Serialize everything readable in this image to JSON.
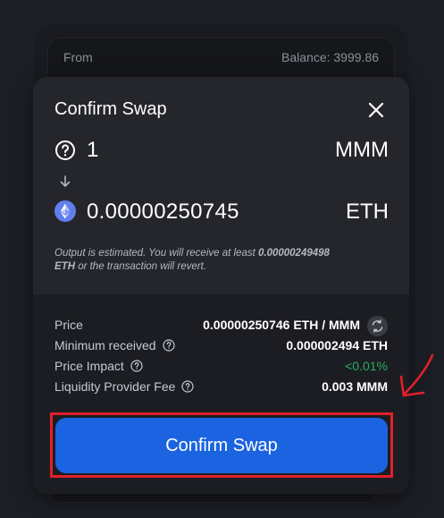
{
  "background": {
    "from_label": "From",
    "balance_text": "Balance: 3999.86"
  },
  "modal": {
    "title": "Confirm Swap",
    "input": {
      "amount": "1",
      "token": "MMM",
      "icon": "question-circle-icon"
    },
    "output": {
      "amount": "0.00000250745",
      "token": "ETH",
      "icon": "ethereum-icon"
    },
    "note": {
      "part1": "Output is estimated. You will receive at least ",
      "min_amount": "0.00000249498",
      "part2": " ETH",
      "part3": " or the transaction will revert."
    },
    "details": {
      "price_label": "Price",
      "price_value": "0.00000250746 ETH / MMM",
      "min_received_label": "Minimum received",
      "min_received_value": "0.000002494 ETH",
      "price_impact_label": "Price Impact",
      "price_impact_value": "<0.01%",
      "lp_fee_label": "Liquidity Provider Fee",
      "lp_fee_value": "0.003 MMM"
    },
    "confirm_label": "Confirm Swap"
  },
  "colors": {
    "accent": "#1b63e0",
    "annotation": "#e0202a",
    "positive": "#27ae60"
  }
}
